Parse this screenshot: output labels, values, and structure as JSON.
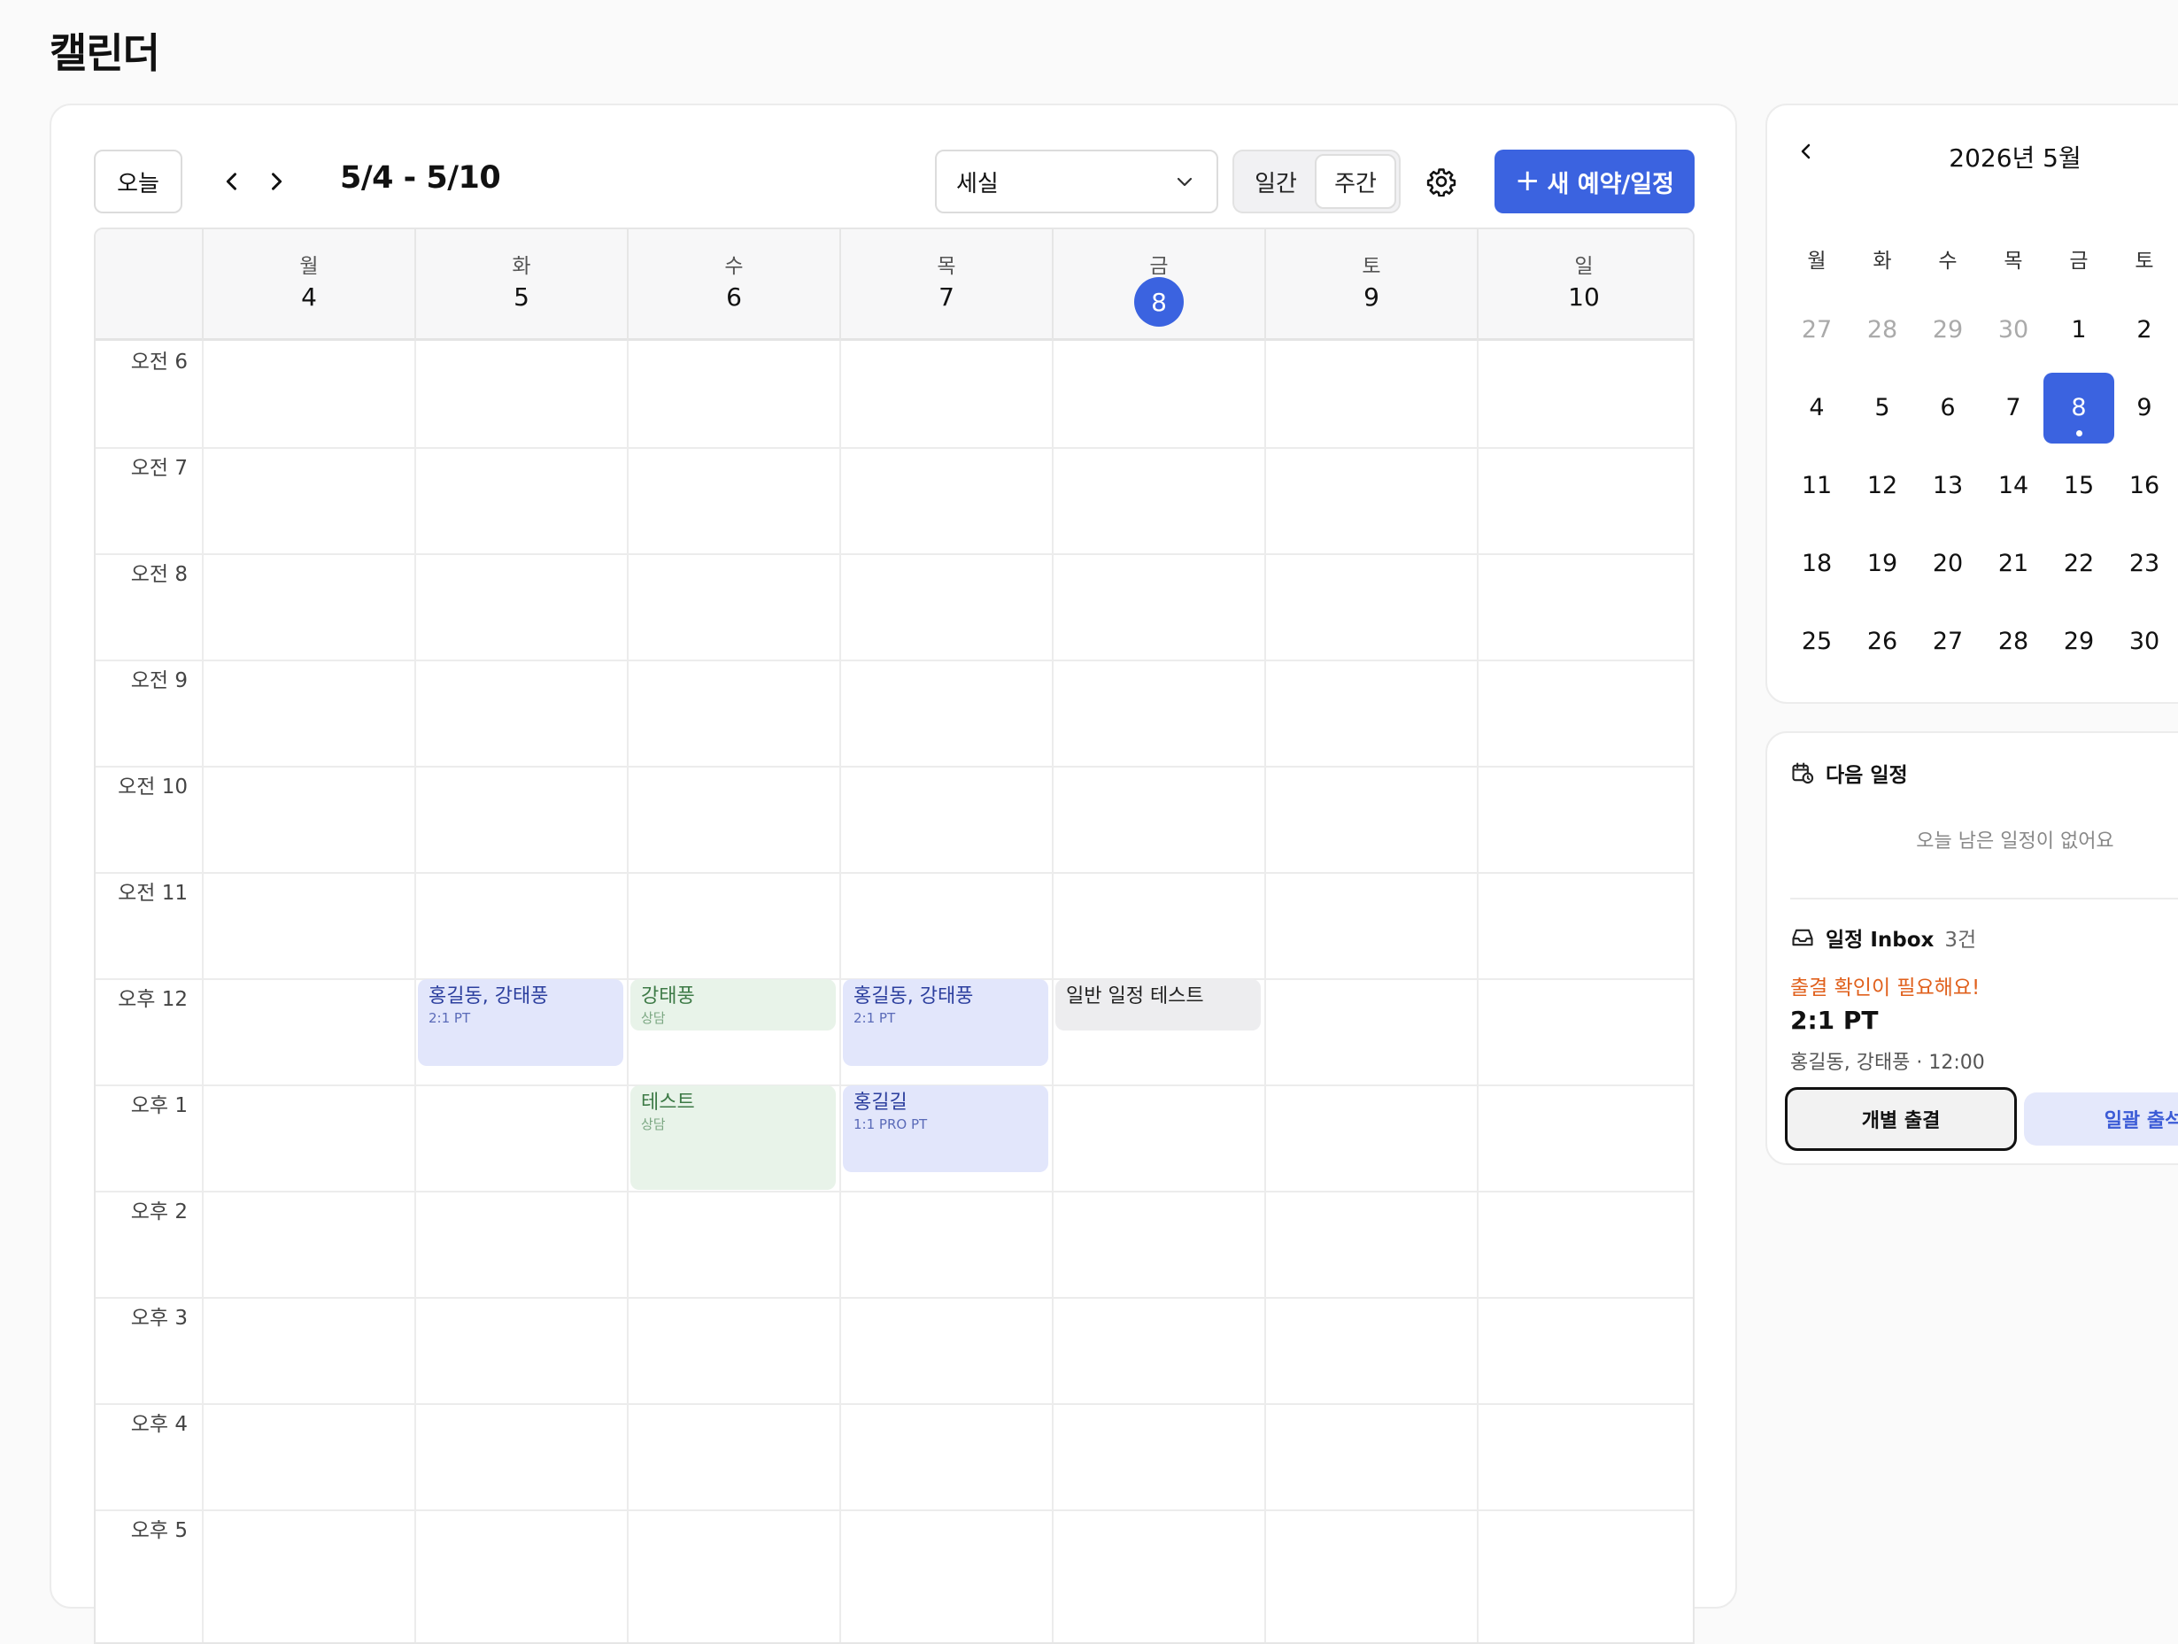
{
  "page": {
    "title": "캘린더"
  },
  "toolbar": {
    "today_label": "오늘",
    "date_range": "5/4 - 5/10",
    "room_select_value": "세실",
    "view_day_label": "일간",
    "view_week_label": "주간",
    "view_active": "주간",
    "new_button_label": "새 예약/일정",
    "new_button_icon": "plus-icon"
  },
  "week": {
    "days": [
      {
        "dow": "월",
        "date": "4"
      },
      {
        "dow": "화",
        "date": "5"
      },
      {
        "dow": "수",
        "date": "6"
      },
      {
        "dow": "목",
        "date": "7"
      },
      {
        "dow": "금",
        "date": "8",
        "today": true
      },
      {
        "dow": "토",
        "date": "9"
      },
      {
        "dow": "일",
        "date": "10"
      }
    ],
    "hours": [
      "오전 6",
      "오전 7",
      "오전 8",
      "오전 9",
      "오전 10",
      "오전 11",
      "오후 12",
      "오후 1",
      "오후 2",
      "오후 3",
      "오후 4",
      "오후 5"
    ],
    "events": [
      {
        "title": "홍길동, 강태풍",
        "sub": "2:1 PT",
        "color": "blue",
        "day": 1,
        "start_hour": 12.0,
        "duration_hours": 0.83
      },
      {
        "title": "강태풍",
        "sub": "상담",
        "color": "green",
        "day": 2,
        "start_hour": 12.0,
        "duration_hours": 0.5
      },
      {
        "title": "테스트",
        "sub": "상담",
        "color": "green",
        "day": 2,
        "start_hour": 13.0,
        "duration_hours": 1.0
      },
      {
        "title": "홍길동, 강태풍",
        "sub": "2:1 PT",
        "color": "blue",
        "day": 3,
        "start_hour": 12.0,
        "duration_hours": 0.83
      },
      {
        "title": "홍길길",
        "sub": "1:1 PRO PT",
        "color": "blue",
        "day": 3,
        "start_hour": 13.0,
        "duration_hours": 0.83
      },
      {
        "title": "일반 일정 테스트",
        "sub": "",
        "color": "gray",
        "day": 4,
        "start_hour": 12.0,
        "duration_hours": 0.5
      }
    ]
  },
  "mini_calendar": {
    "title": "2026년 5월",
    "dows": [
      "월",
      "화",
      "수",
      "목",
      "금",
      "토"
    ],
    "weeks": [
      [
        {
          "d": "27",
          "m": true
        },
        {
          "d": "28",
          "m": true
        },
        {
          "d": "29",
          "m": true
        },
        {
          "d": "30",
          "m": true
        },
        {
          "d": "1"
        },
        {
          "d": "2"
        }
      ],
      [
        {
          "d": "4"
        },
        {
          "d": "5"
        },
        {
          "d": "6"
        },
        {
          "d": "7"
        },
        {
          "d": "8",
          "sel": true
        },
        {
          "d": "9"
        }
      ],
      [
        {
          "d": "11"
        },
        {
          "d": "12"
        },
        {
          "d": "13"
        },
        {
          "d": "14"
        },
        {
          "d": "15"
        },
        {
          "d": "16"
        }
      ],
      [
        {
          "d": "18"
        },
        {
          "d": "19"
        },
        {
          "d": "20"
        },
        {
          "d": "21"
        },
        {
          "d": "22"
        },
        {
          "d": "23"
        }
      ],
      [
        {
          "d": "25"
        },
        {
          "d": "26"
        },
        {
          "d": "27"
        },
        {
          "d": "28"
        },
        {
          "d": "29"
        },
        {
          "d": "30"
        }
      ]
    ]
  },
  "next_schedule": {
    "title": "다음 일정",
    "empty_text": "오늘 남은 일정이 없어요"
  },
  "inbox": {
    "title": "일정 Inbox",
    "count": "3건",
    "alert": "출결 확인이 필요해요!",
    "item_title": "2:1 PT",
    "item_meta": "홍길동, 강태풍 · 12:00",
    "individual_button": "개별 출결",
    "bulk_button": "일괄 출석"
  },
  "colors": {
    "accent": "#3b63e0",
    "event_blue": "#e2e6fb",
    "event_green": "#e8f3e9",
    "event_gray": "#ededef",
    "alert": "#e0601c"
  }
}
